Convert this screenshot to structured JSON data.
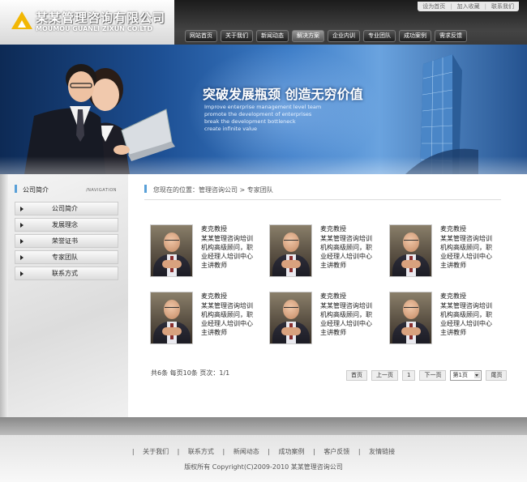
{
  "header": {
    "company_cn": "某某管理咨询有限公司",
    "company_en": "MOUMOU GUANLI ZIXUN CO.LTD",
    "toplinks": [
      "设为首页",
      "加入收藏",
      "联系我们"
    ],
    "nav": [
      "网站首页",
      "关于我们",
      "新闻动态",
      "解决方案",
      "企业内训",
      "专业团队",
      "成功案例",
      "需求反馈"
    ]
  },
  "banner": {
    "slogan": "突破发展瓶颈 创造无穷价值",
    "en_lines": [
      "Improve enterprise management level team",
      "promote the development of enterprises",
      "break the development bottleneck",
      "create infinite value"
    ]
  },
  "sidebar": {
    "title": "公司简介",
    "title_en": "/NAVIGATION",
    "items": [
      "公司简介",
      "发展理念",
      "荣誉证书",
      "专家团队",
      "联系方式"
    ]
  },
  "breadcrumb": "您现在的位置：管理咨询公司 > 专家团队",
  "experts": [
    {
      "name": "麦克教授",
      "desc": "某某管理咨询培训机构高级顾问，职业经理人培训中心主讲教师"
    },
    {
      "name": "麦克教授",
      "desc": "某某管理咨询培训机构高级顾问，职业经理人培训中心主讲教师"
    },
    {
      "name": "麦克教授",
      "desc": "某某管理咨询培训机构高级顾问，职业经理人培训中心主讲教师"
    },
    {
      "name": "麦克教授",
      "desc": "某某管理咨询培训机构高级顾问，职业经理人培训中心主讲教师"
    },
    {
      "name": "麦克教授",
      "desc": "某某管理咨询培训机构高级顾问，职业经理人培训中心主讲教师"
    },
    {
      "name": "麦克教授",
      "desc": "某某管理咨询培训机构高级顾问，职业经理人培训中心主讲教师"
    }
  ],
  "pagination": {
    "stats": "共6条  每页10条  页次：1/1",
    "first": "首页",
    "prev": "上一页",
    "current": "1",
    "next": "下一页",
    "select": "第1页",
    "last": "尾页"
  },
  "footer": {
    "links": [
      "关于我们",
      "联系方式",
      "新闻动态",
      "成功案例",
      "客户反馈",
      "友情链接"
    ],
    "copyright": "版权所有  Copyright(C)2009-2010 某某管理咨询公司"
  }
}
